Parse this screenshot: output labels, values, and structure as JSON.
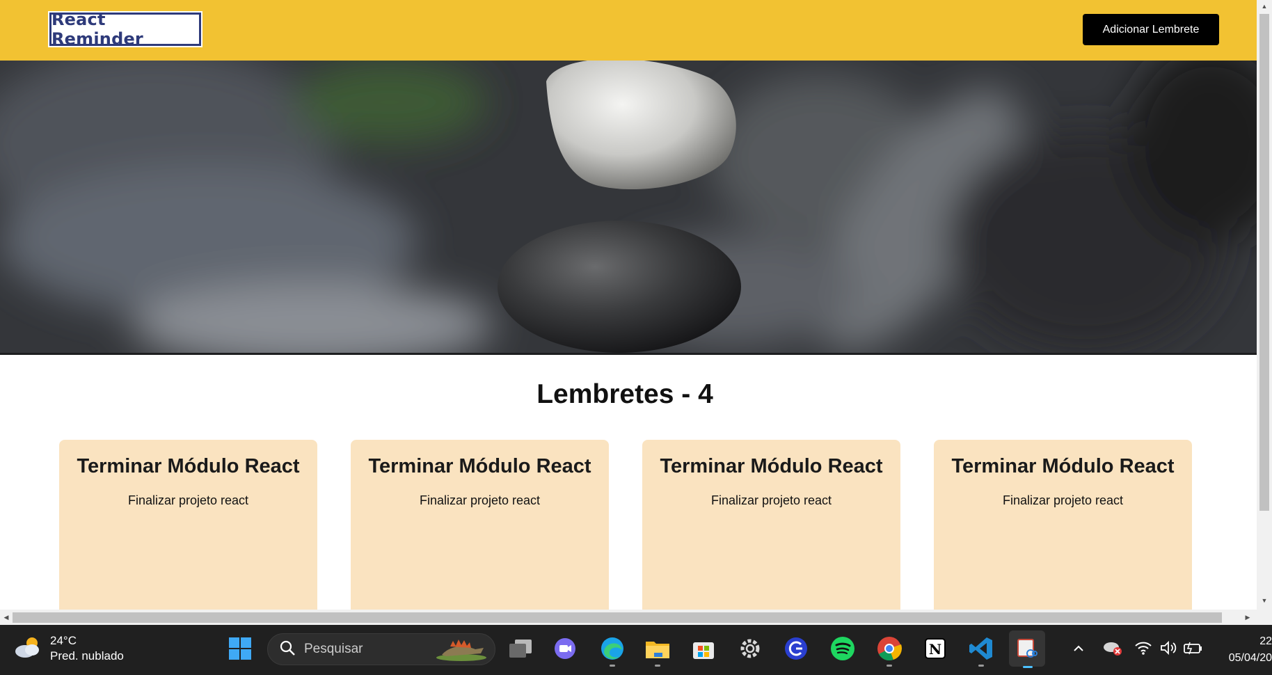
{
  "header": {
    "logo_text": "React Reminder",
    "add_button_label": "Adicionar Lembrete",
    "background_color": "#f2c232"
  },
  "main": {
    "section_title": "Lembretes - 4",
    "cards": [
      {
        "title": "Terminar Módulo React",
        "description": "Finalizar projeto react"
      },
      {
        "title": "Terminar Módulo React",
        "description": "Finalizar projeto react"
      },
      {
        "title": "Terminar Módulo React",
        "description": "Finalizar projeto react"
      },
      {
        "title": "Terminar Módulo React",
        "description": "Finalizar projeto react"
      }
    ],
    "card_color": "#fae3c0"
  },
  "taskbar": {
    "weather": {
      "temperature": "24°C",
      "condition": "Pred. nublado"
    },
    "search_placeholder": "Pesquisar",
    "apps": [
      "start-icon",
      "task-view-icon",
      "chat-icon",
      "edge-icon",
      "file-explorer-icon",
      "store-icon",
      "settings-icon",
      "search-app-icon",
      "spotify-icon",
      "chrome-icon",
      "notion-icon",
      "vscode-icon",
      "snipping-tool-icon"
    ],
    "clock": {
      "time": "22",
      "date": "05/04/20"
    }
  }
}
